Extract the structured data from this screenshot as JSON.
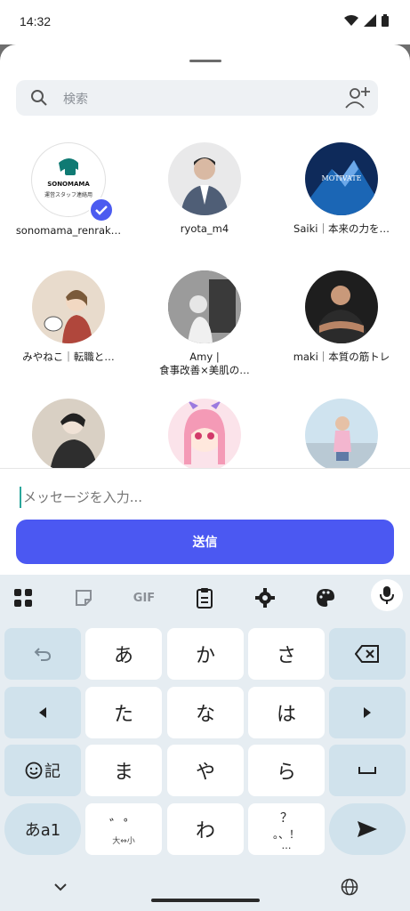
{
  "status": {
    "time": "14:32"
  },
  "search": {
    "placeholder": "検索"
  },
  "users": [
    {
      "name": "sonomama_renrak…",
      "verified": true,
      "logo_text": "SONOMAMA",
      "logo_sub": "運営スタッフ連絡用"
    },
    {
      "name": "ryota_m4"
    },
    {
      "name": "Saiki｜本来の力を…",
      "badge_text": "MOTIVATE"
    },
    {
      "name": "みやねこ｜転職と…"
    },
    {
      "name": "Amy |",
      "name2": "食事改善×美肌の…"
    },
    {
      "name": "maki｜本質の筋トレ"
    },
    {
      "name": ""
    },
    {
      "name": ""
    },
    {
      "name": ""
    }
  ],
  "composer": {
    "placeholder": "メッセージを入力...",
    "send_label": "送信"
  },
  "keyboard": {
    "toolbar": [
      "apps-icon",
      "sticker-icon",
      "GIF",
      "clipboard-icon",
      "settings-icon",
      "palette-icon",
      "mic-icon"
    ],
    "gif_label": "GIF",
    "keys": {
      "a": "あ",
      "ka": "か",
      "sa": "さ",
      "ta": "た",
      "na": "な",
      "ha": "は",
      "ma": "ま",
      "ya": "や",
      "ra": "ら",
      "wa": "わ",
      "emoji_label": "記",
      "mode_label": "あa1",
      "dakuten_label": "゛゜",
      "dakuten_sub": "大⇔小",
      "punct_label": "？",
      "punct_sub": "。、！",
      "punct_sub2": "…"
    }
  },
  "colors": {
    "accent": "#4b58f2",
    "verified": "#4b5bf0",
    "fn_key": "#d0e2ec"
  }
}
